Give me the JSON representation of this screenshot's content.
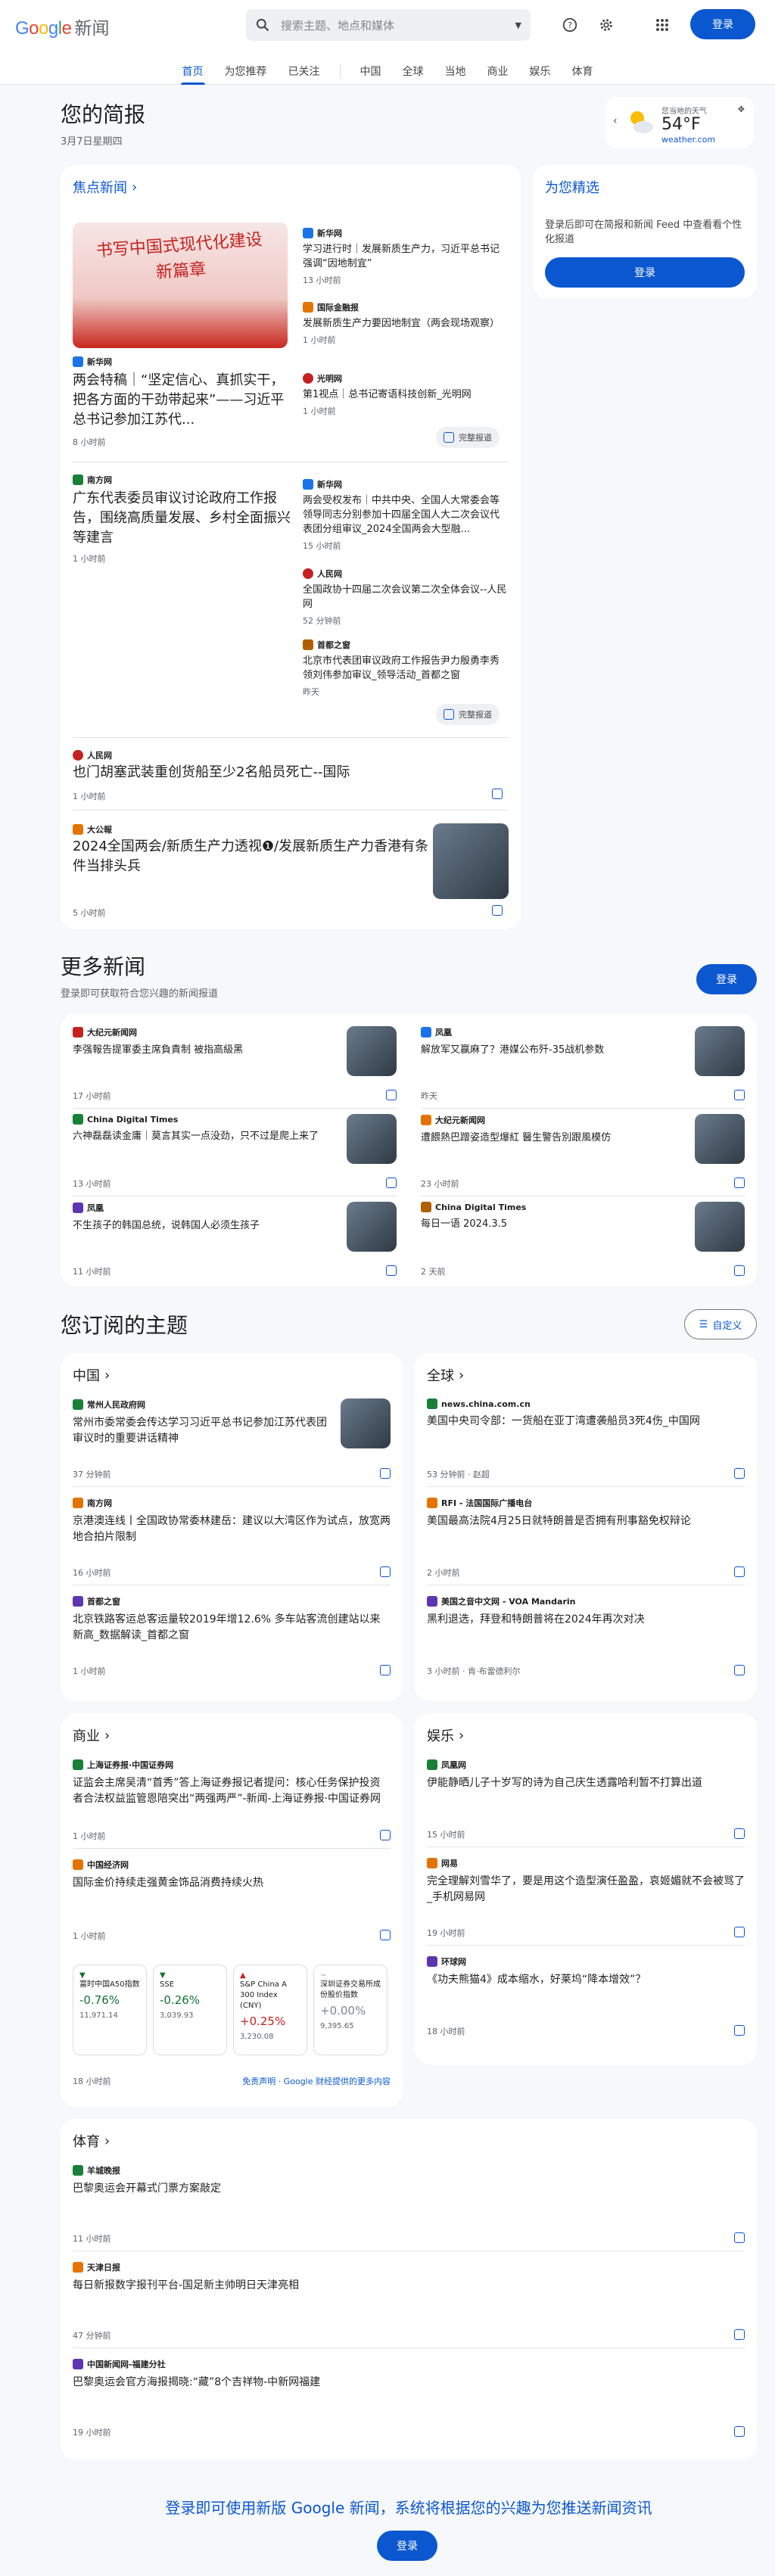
{
  "header": {
    "logo_google": "Google",
    "logo_news": "新闻",
    "search_placeholder": "搜索主题、地点和媒体",
    "signin": "登录"
  },
  "nav": {
    "tabs": [
      "首页",
      "为您推荐",
      "已关注",
      "中国",
      "全球",
      "当地",
      "商业",
      "娱乐",
      "体育"
    ]
  },
  "briefing": {
    "title": "您的简报",
    "date": "3月7日星期四"
  },
  "weather": {
    "label": "您当地的天气",
    "temp": "54°F",
    "source": "weather.com"
  },
  "top": {
    "heading": "焦点新闻",
    "story1": {
      "image_text": "书写中国式现代化建设新篇章",
      "source": "新华网",
      "title": "两会特稿｜“坚定信心、真抓实干，把各方面的干劲带起来”——习近平总书记参加江苏代...",
      "time": "8 小时前"
    },
    "side1": [
      {
        "source": "新华网",
        "title": "学习进行时｜发展新质生产力，习近平总书记强调“因地制宜”",
        "time": "13 小时前"
      },
      {
        "source": "国际金融报",
        "title": "发展新质生产力要因地制宜（两会现场观察）",
        "time": "1 小时前"
      },
      {
        "source": "光明网",
        "title": "第1视点｜总书记寄语科技创新_光明网",
        "time": "1 小时前"
      }
    ],
    "coverage": "完整报道",
    "story2": {
      "source": "南方网",
      "title": "广东代表委员审议讨论政府工作报告，围绕高质量发展、乡村全面振兴等建言",
      "time": "1 小时前"
    },
    "side2": [
      {
        "source": "新华网",
        "title": "两会受权发布｜中共中央、全国人大常委会等领导同志分别参加十四届全国人大二次会议代表团分组审议_2024全国两会大型融...",
        "time": "15 小时前"
      },
      {
        "source": "人民网",
        "title": "全国政协十四届二次会议第二次全体会议--人民网",
        "time": "52 分钟前"
      },
      {
        "source": "首都之窗",
        "title": "北京市代表团审议政府工作报告尹力殷勇李秀领刘伟参加审议_领导活动_首都之窗",
        "time": "昨天"
      }
    ],
    "story3": {
      "source": "人民网",
      "title": "也门胡塞武装重创货船至少2名船员死亡--国际",
      "time": "1 小时前"
    },
    "story4": {
      "source": "大公報",
      "title": "2024全国两会/新质生产力透视❶/发展新质生产力香港有条件当排头兵",
      "time": "5 小时前"
    }
  },
  "picks": {
    "title": "为您精选",
    "desc": "登录后即可在简报和新闻 Feed 中查看看个性化报道",
    "button": "登录"
  },
  "more": {
    "title": "更多新闻",
    "subtitle": "登录即可获取符合您兴趣的新闻报道",
    "button": "登录",
    "items": [
      {
        "source": "大纪元新闻网",
        "title": "李强報告提軍委主席負責制 被指高級黑",
        "time": "17 小时前"
      },
      {
        "source": "凤凰",
        "title": "解放军又赢麻了？港媒公布歼-35战机参数",
        "time": "昨天"
      },
      {
        "source": "China Digital Times",
        "title": "六神磊磊读金庸｜莫言其实一点没劲，只不过是爬上来了",
        "time": "13 小时前"
      },
      {
        "source": "大纪元新闻网",
        "title": "遭餵熱巴蹭姿造型爆紅 醫生警告別跟風模仿",
        "time": "23 小时前"
      },
      {
        "source": "凤凰",
        "title": "不生孩子的韩国总统，说韩国人必须生孩子",
        "time": "11 小时前"
      },
      {
        "source": "China Digital Times",
        "title": "每日一语 2024.3.5",
        "time": "2 天前"
      }
    ]
  },
  "topics": {
    "title": "您订阅的主题",
    "customize": "自定义",
    "china": {
      "heading": "中国",
      "items": [
        {
          "source": "常州人民政府网",
          "title": "常州市委常委会传达学习习近平总书记参加江苏代表团审议时的重要讲话精神",
          "time": "37 分钟前"
        },
        {
          "source": "南方网",
          "title": "京港澳连线丨全国政协常委林建岳：建议以大湾区作为试点，放宽两地合拍片限制",
          "time": "16 小时前"
        },
        {
          "source": "首都之窗",
          "title": "北京铁路客运总客运量较2019年增12.6% 多车站客流创建站以来新高_数据解读_首都之窗",
          "time": "1 小时前"
        }
      ]
    },
    "world": {
      "heading": "全球",
      "items": [
        {
          "source": "news.china.com.cn",
          "title": "美国中央司令部：一货船在亚丁湾遭袭船员3死4伤_中国网",
          "time": "53 分钟前 · 赵超"
        },
        {
          "source": "RFI - 法国国际广播电台",
          "title": "美国最高法院4月25日就特朗普是否拥有刑事豁免权辩论",
          "time": "2 小时前"
        },
        {
          "source": "美国之音中文网 - VOA Mandarin",
          "title": "黑利退选，拜登和特朗普将在2024年再次对决",
          "time": "3 小时前 · 肯·布雷德利尔"
        }
      ]
    },
    "business": {
      "heading": "商业",
      "items": [
        {
          "source": "上海证券报·中国证券网",
          "title": "证监会主席吴清“首秀”答上海证券报记者提问：核心任务保护投资者合法权益监管恩陪突出“两强两严”-新闻-上海证券报·中国证券网",
          "time": "1 小时前"
        },
        {
          "source": "中国经济网",
          "title": "国际金价持续走强黄金饰品消费持续火热",
          "time": "1 小时前"
        }
      ],
      "tickers": [
        {
          "name": "富时中国A50指数",
          "pct": "-0.76%",
          "val": "11,971.14",
          "dir": "down"
        },
        {
          "name": "SSE",
          "pct": "-0.26%",
          "val": "3,039.93",
          "dir": "down"
        },
        {
          "name": "S&P China A 300 Index (CNY)",
          "pct": "+0.25%",
          "val": "3,230.08",
          "dir": "up"
        },
        {
          "name": "深圳证券交易所成份股价指数",
          "pct": "+0.00%",
          "val": "9,395.65",
          "dir": "flat"
        }
      ],
      "footer_time": "18 小时前",
      "disclaimer": "免责声明 · Google 财经提供的更多内容"
    },
    "ent": {
      "heading": "娱乐",
      "items": [
        {
          "source": "凤凰网",
          "title": "伊能静晒儿子十岁写的诗为自己庆生透露哈利暂不打算出道",
          "time": "15 小时前"
        },
        {
          "source": "网易",
          "title": "完全理解刘雪华了，要是用这个造型演任盈盈，哀姬媚就不会被骂了_手机网易网",
          "time": "19 小时前"
        },
        {
          "source": "环球网",
          "title": "《功夫熊猫4》成本缩水，好莱坞“降本增效”？",
          "time": "18 小时前"
        }
      ]
    },
    "sports": {
      "heading": "体育",
      "items": [
        {
          "source": "羊城晚报",
          "title": "巴黎奥运会开幕式门票方案敲定",
          "time": "11 小时前"
        },
        {
          "source": "天津日报",
          "title": "每日新报数字报刊平台-国足新主帅明日天津亮相",
          "time": "47 分钟前"
        },
        {
          "source": "中国新闻网-福建分社",
          "title": "巴黎奥运会官方海报揭晓:“藏”8个吉祥物-中新网福建",
          "time": "19 小时前"
        }
      ]
    }
  },
  "footer": {
    "title": "登录即可使用新版 Google 新闻，系统将根据您的兴趣为您推送新闻资讯",
    "button": "登录"
  },
  "colors": {
    "accent": "#0b57d0",
    "green": "#137333",
    "red": "#c5221f"
  }
}
